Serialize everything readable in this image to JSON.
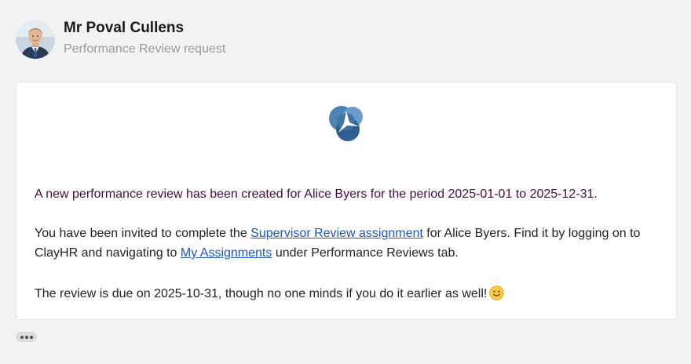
{
  "sender": {
    "name": "Mr Poval Cullens",
    "subject": "Performance Review request"
  },
  "message": {
    "line1": "A new performance review has been created for Alice Byers for the period 2025-01-01 to 2025-12-31.",
    "p2_before_link": "You have been invited to complete the ",
    "p2_link1": "Supervisor Review assignment",
    "p2_middle": " for Alice Byers. Find it by logging on to ClayHR and navigating to ",
    "p2_link2": "My Assignments",
    "p2_after": " under Performance Reviews tab.",
    "p3": "The review is due on 2025-10-31, though no one minds if you do it earlier as well!",
    "emoji_icon": "slightly-smiling-face-icon"
  },
  "colors": {
    "background": "#f3f3f3",
    "headline_text": "#4a0a47",
    "link": "#1a56c4",
    "subject_text": "#9a9a9a"
  },
  "icons": {
    "logo": "clayhr-logo-icon",
    "more": "more-dots-icon"
  }
}
